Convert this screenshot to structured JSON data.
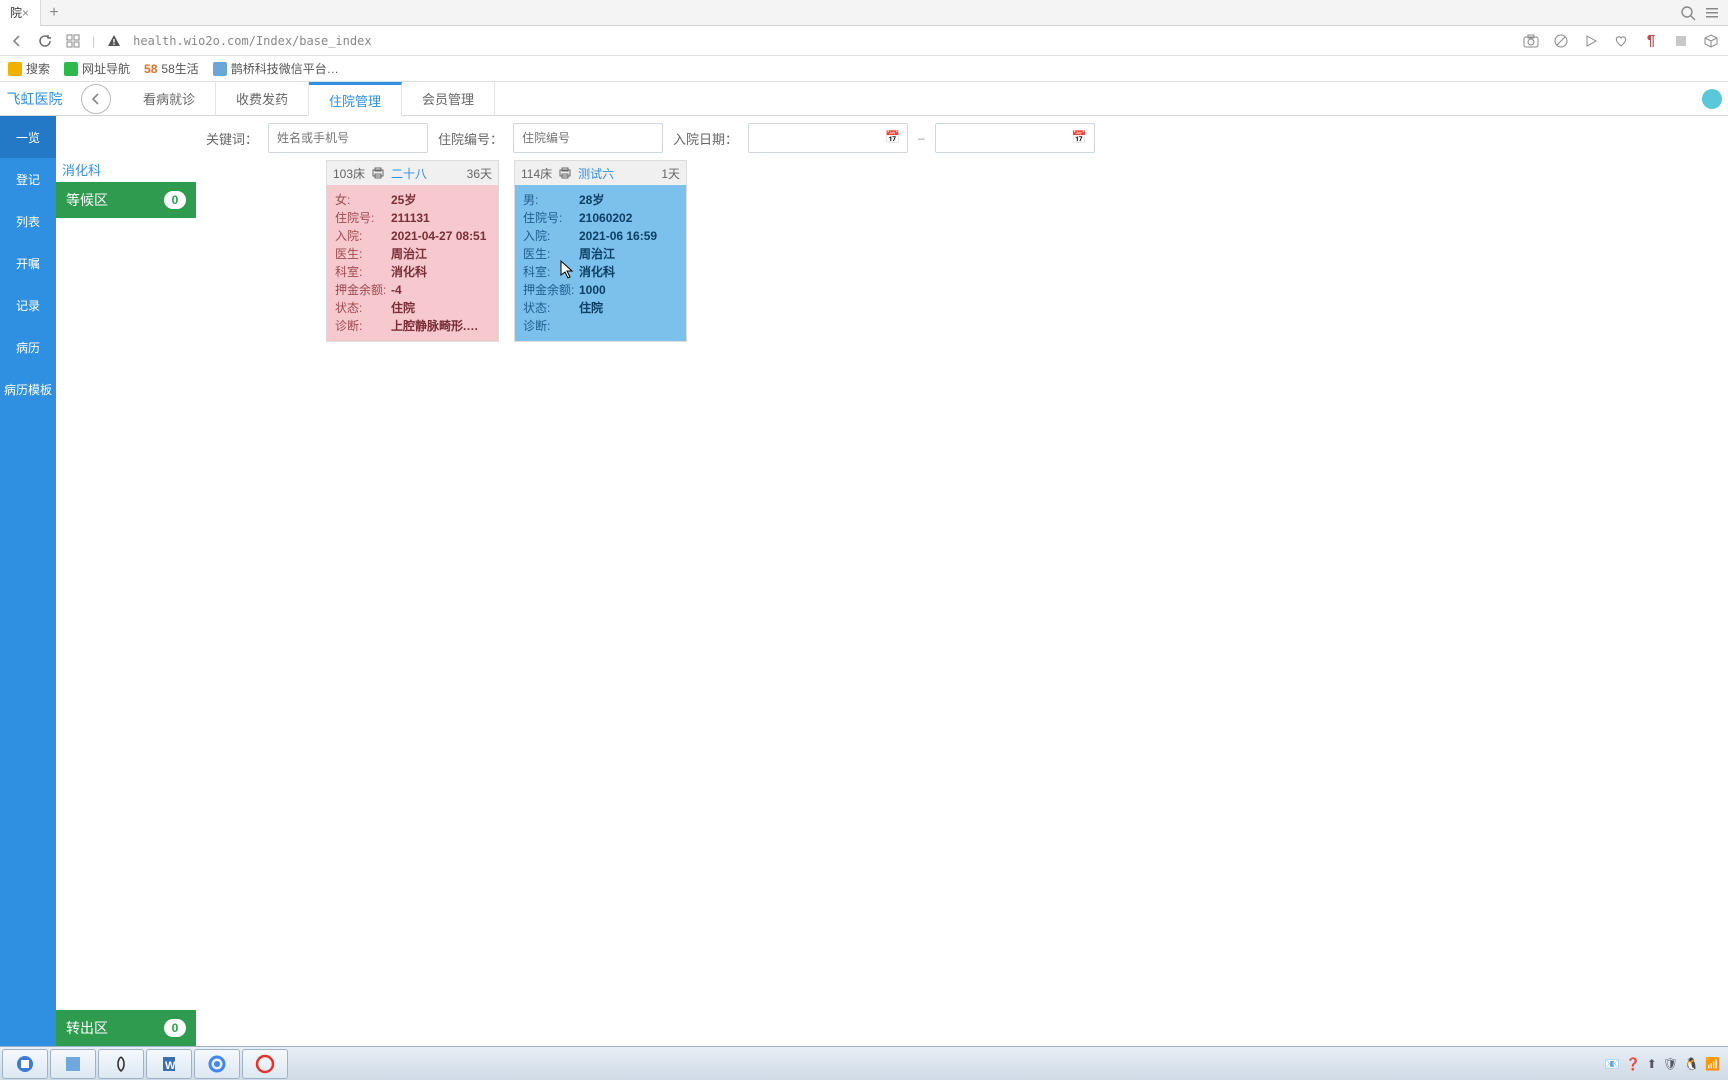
{
  "browser": {
    "tab_title": "院",
    "url": "health.wio2o.com/Index/base_index"
  },
  "bookmarks": [
    {
      "label": "搜索",
      "color": "#f0b100"
    },
    {
      "label": "网址导航",
      "color": "#2fb94a"
    },
    {
      "label": "58生活",
      "color": "#f06a1f",
      "prefix": "58"
    },
    {
      "label": "鹊桥科技微信平台…",
      "color": "#6aa6d8"
    }
  ],
  "app": {
    "name": "飞虹医院",
    "tabs": [
      "看病就诊",
      "收费发药",
      "住院管理",
      "会员管理"
    ],
    "active_tab": 2
  },
  "leftnav": [
    "一览",
    "登记",
    "列表",
    "开嘱",
    "记录",
    "病历",
    "病历模板"
  ],
  "leftnav_active": 0,
  "sidegroups": {
    "wait": {
      "label": "等候区",
      "count": "0"
    },
    "out": {
      "label": "转出区",
      "count": "0"
    }
  },
  "filters": {
    "kw_label": "关键词：",
    "kw_ph": "姓名或手机号",
    "no_label": "住院编号：",
    "no_ph": "住院编号",
    "dt_label": "入院日期："
  },
  "dept": "消化科",
  "cards": [
    {
      "tone": "pink",
      "bed": "103床",
      "patient": "二十八",
      "days": "36天",
      "rows": [
        {
          "k": "女:",
          "v": "25岁"
        },
        {
          "k": "住院号:",
          "v": "211131"
        },
        {
          "k": "入院:",
          "v": "2021-04-27 08:51"
        },
        {
          "k": "医生:",
          "v": "周治江"
        },
        {
          "k": "科室:",
          "v": "消化科"
        },
        {
          "k": "押金余额:",
          "v": "-4"
        },
        {
          "k": "状态:",
          "v": "住院"
        },
        {
          "k": "诊断:",
          "v": "上腔静脉畸形.…"
        }
      ]
    },
    {
      "tone": "blue",
      "bed": "114床",
      "patient": "测试六",
      "days": "1天",
      "rows": [
        {
          "k": "男:",
          "v": "28岁"
        },
        {
          "k": "住院号:",
          "v": "21060202"
        },
        {
          "k": "入院:",
          "v": "2021-06 16:59"
        },
        {
          "k": "医生:",
          "v": "周治江"
        },
        {
          "k": "科室:",
          "v": "消化科"
        },
        {
          "k": "押金余额:",
          "v": "1000"
        },
        {
          "k": "状态:",
          "v": "住院"
        },
        {
          "k": "诊断:",
          "v": ""
        }
      ]
    }
  ]
}
